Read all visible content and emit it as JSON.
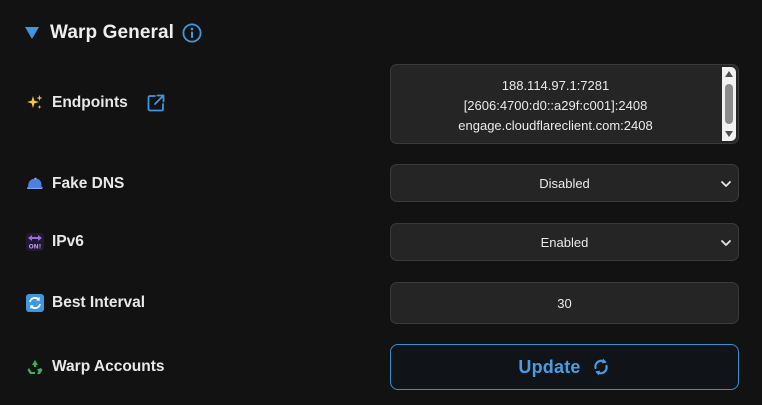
{
  "section": {
    "title": "Warp General",
    "icons": {
      "toggle": "triangle-down-icon",
      "info": "info-icon"
    }
  },
  "rows": {
    "endpoints": {
      "label": "Endpoints",
      "icon": "sparkles-icon",
      "link_icon": "external-link-icon",
      "lines": [
        "188.114.97.1:7281",
        "[2606:4700:d0::a29f:c001]:2408",
        "engage.cloudflareclient.com:2408"
      ]
    },
    "fake_dns": {
      "label": "Fake DNS",
      "icon": "cap-icon",
      "value": "Disabled"
    },
    "ipv6": {
      "label": "IPv6",
      "icon": "on-arrows-icon",
      "value": "Enabled"
    },
    "best_interval": {
      "label": "Best Interval",
      "icon": "repeat-icon",
      "value": "30"
    },
    "warp_accounts": {
      "label": "Warp Accounts",
      "icon": "recycle-icon",
      "button_label": "Update",
      "button_icon": "sync-icon"
    }
  },
  "colors": {
    "accent": "#3b8fd1",
    "background": "#121212",
    "control_bg": "#252525"
  }
}
